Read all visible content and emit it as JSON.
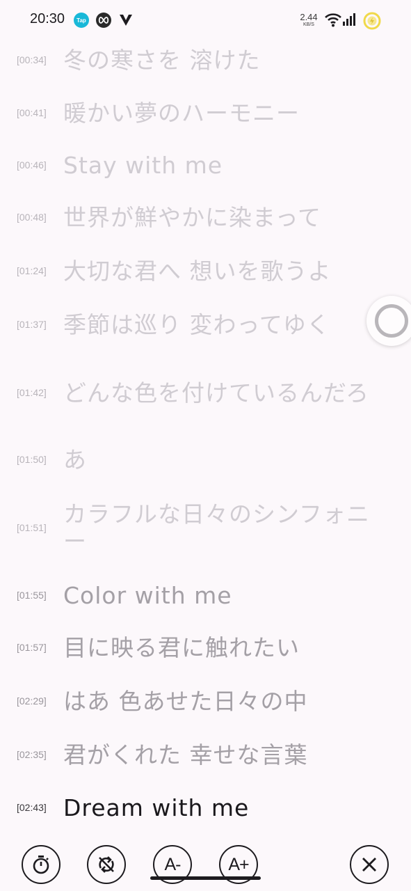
{
  "status_bar": {
    "time": "20:30",
    "tap_badge": "Tap",
    "net_speed_value": "2.44",
    "net_speed_unit": "KB/S",
    "icons": [
      "tap-icon",
      "infinity-icon",
      "v-icon",
      "wifi-icon",
      "signal-icon",
      "battery-charging-icon"
    ]
  },
  "lyrics": [
    {
      "time": "[00:34]",
      "text": "冬の寒さを 溶けた"
    },
    {
      "time": "[00:41]",
      "text": "暖かい夢のハーモニー"
    },
    {
      "time": "[00:46]",
      "text": "Stay with me"
    },
    {
      "time": "[00:48]",
      "text": "世界が鮮やかに染まって"
    },
    {
      "time": "[01:24]",
      "text": "大切な君へ 想いを歌うよ"
    },
    {
      "time": "[01:37]",
      "text": "季節は巡り 変わってゆく"
    },
    {
      "time": "[01:42]",
      "text": "どんな色を付けているんだろ"
    },
    {
      "time": "[01:50]",
      "text": "あ"
    },
    {
      "time": "[01:51]",
      "text": "カラフルな日々のシンフォニー"
    },
    {
      "time": "[01:55]",
      "text": "Color with me"
    },
    {
      "time": "[01:57]",
      "text": "目に映る君に触れたい"
    },
    {
      "time": "[02:29]",
      "text": "はあ 色あせた日々の中"
    },
    {
      "time": "[02:35]",
      "text": "君がくれた 幸せな言葉"
    },
    {
      "time": "[02:43]",
      "text": "Dream with me"
    }
  ],
  "toolbar": {
    "timer_icon": "timer-icon",
    "repeat_off_icon": "repeat-off-icon",
    "font_decrease_label": "A-",
    "font_increase_label": "A+",
    "close_icon": "close-icon"
  },
  "colors": {
    "background": "#fcf8fb",
    "active_lyric": "#1a181c",
    "inactive_lyric": "#d0ccd2",
    "tap_badge": "#19b8d8"
  }
}
